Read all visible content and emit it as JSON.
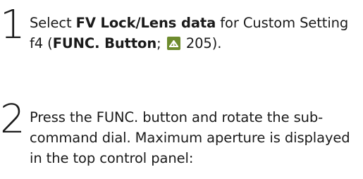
{
  "step1": {
    "number": "1",
    "t1": "Select ",
    "b1": "FV Lock/Lens data",
    "t2": " for Custom Setting f4 (",
    "b2": "FUNC. Button",
    "t3": "; ",
    "page_ref_icon": "page-reference-icon",
    "t4": " 205)."
  },
  "step2": {
    "number": "2",
    "text": "Press the FUNC. button and rotate the sub-command dial.  Maximum aperture is displayed in the top control panel:"
  }
}
